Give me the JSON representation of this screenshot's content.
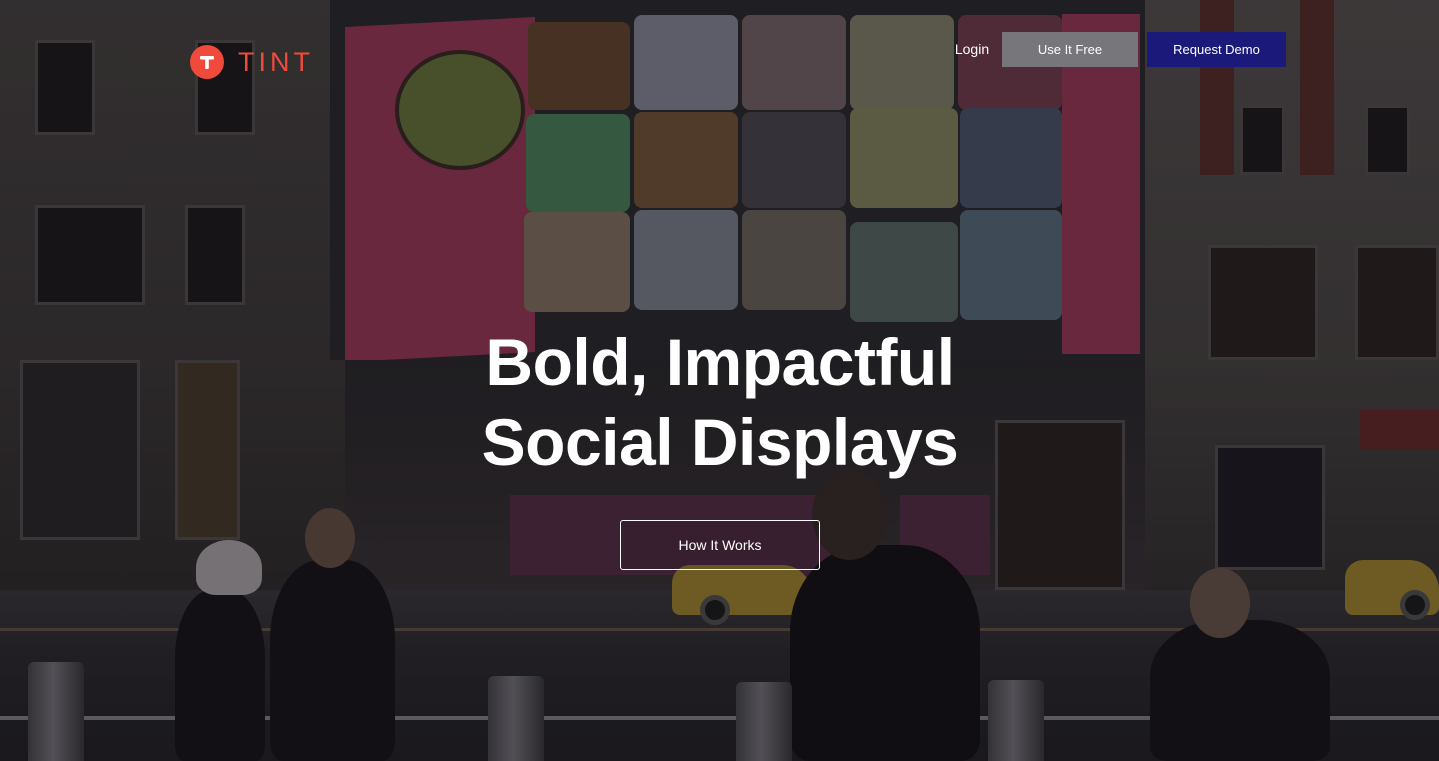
{
  "brand": {
    "name": "TINT",
    "color": "#f04a3c"
  },
  "nav": {
    "login_label": "Login",
    "use_free_label": "Use It Free",
    "request_demo_label": "Request Demo"
  },
  "hero": {
    "title_line1": "Bold, Impactful",
    "title_line2": "Social Displays",
    "cta_label": "How It Works"
  },
  "colors": {
    "use_free_bg": "#77767a",
    "request_demo_bg": "#1b1a7a",
    "text": "#ffffff"
  },
  "icons": {
    "brand_mark": "tint-t-logo-icon"
  }
}
